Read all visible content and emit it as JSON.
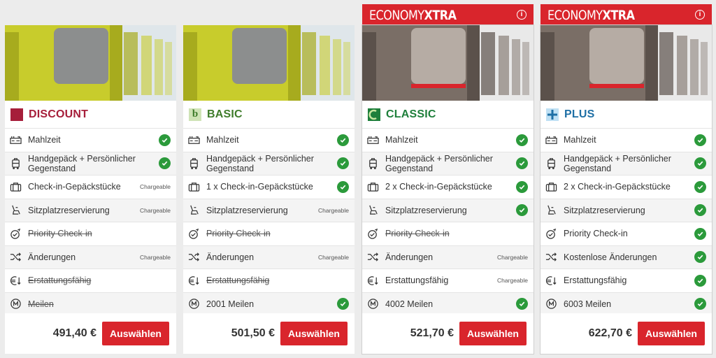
{
  "banner": {
    "economy": "ECONOMY",
    "xtra": "XTRA",
    "info_icon": "info-icon"
  },
  "colors": {
    "brand_red": "#d9252c",
    "discount": "#a61e3a",
    "basic": "#3f7c2b",
    "classic": "#1e7f3b",
    "plus": "#1e6fa5",
    "check_green": "#2b9a3b"
  },
  "cards": [
    {
      "name": "DISCOUNT",
      "icon": "discount-square-icon",
      "color": "#a61e3a",
      "price": "491,40 €",
      "button": "Auswählen",
      "features": [
        {
          "label": "Mahlzeit",
          "status": "check"
        },
        {
          "label": "Handgepäck + Persönlicher Gegenstand",
          "status": "check"
        },
        {
          "label": "Check-in-Gepäckstücke",
          "status": "Chargeable"
        },
        {
          "label": "Sitzplatzreservierung",
          "status": "Chargeable"
        },
        {
          "label": "Priority Check-in",
          "status": "none",
          "struck": true
        },
        {
          "label": "Änderungen",
          "status": "Chargeable"
        },
        {
          "label": "Erstattungsfähig",
          "status": "none",
          "struck": true
        },
        {
          "label": "Meilen",
          "status": "none",
          "struck": true
        }
      ]
    },
    {
      "name": "BASIC",
      "icon": "basic-b-icon",
      "color": "#3f7c2b",
      "price": "501,50 €",
      "button": "Auswählen",
      "features": [
        {
          "label": "Mahlzeit",
          "status": "check"
        },
        {
          "label": "Handgepäck + Persönlicher Gegenstand",
          "status": "check"
        },
        {
          "label": "1 x Check-in-Gepäckstücke",
          "status": "check"
        },
        {
          "label": "Sitzplatzreservierung",
          "status": "Chargeable"
        },
        {
          "label": "Priority Check-in",
          "status": "none",
          "struck": true
        },
        {
          "label": "Änderungen",
          "status": "Chargeable"
        },
        {
          "label": "Erstattungsfähig",
          "status": "none",
          "struck": true
        },
        {
          "label": "2001 Meilen",
          "status": "check"
        }
      ]
    },
    {
      "name": "CLASSIC",
      "icon": "classic-c-icon",
      "color": "#1e7f3b",
      "price": "521,70 €",
      "button": "Auswählen",
      "features": [
        {
          "label": "Mahlzeit",
          "status": "check"
        },
        {
          "label": "Handgepäck + Persönlicher Gegenstand",
          "status": "check"
        },
        {
          "label": "2 x Check-in-Gepäckstücke",
          "status": "check"
        },
        {
          "label": "Sitzplatzreservierung",
          "status": "check"
        },
        {
          "label": "Priority Check-in",
          "status": "none",
          "struck": true
        },
        {
          "label": "Änderungen",
          "status": "Chargeable"
        },
        {
          "label": "Erstattungsfähig",
          "status": "Chargeable"
        },
        {
          "label": "4002 Meilen",
          "status": "check"
        }
      ]
    },
    {
      "name": "PLUS",
      "icon": "plus-cross-icon",
      "color": "#1e6fa5",
      "price": "622,70 €",
      "button": "Auswählen",
      "features": [
        {
          "label": "Mahlzeit",
          "status": "check"
        },
        {
          "label": "Handgepäck + Persönlicher Gegenstand",
          "status": "check"
        },
        {
          "label": "2 x Check-in-Gepäckstücke",
          "status": "check"
        },
        {
          "label": "Sitzplatzreservierung",
          "status": "check"
        },
        {
          "label": "Priority Check-in",
          "status": "check"
        },
        {
          "label": "Kostenlose Änderungen",
          "status": "check"
        },
        {
          "label": "Erstattungsfähig",
          "status": "check"
        },
        {
          "label": "6003 Meilen",
          "status": "check"
        }
      ]
    }
  ],
  "feature_icons": [
    "meal-icon",
    "carry-on-bag-icon",
    "checked-luggage-icon",
    "seat-icon",
    "priority-checkin-icon",
    "shuffle-changes-icon",
    "refund-icon",
    "miles-icon"
  ]
}
